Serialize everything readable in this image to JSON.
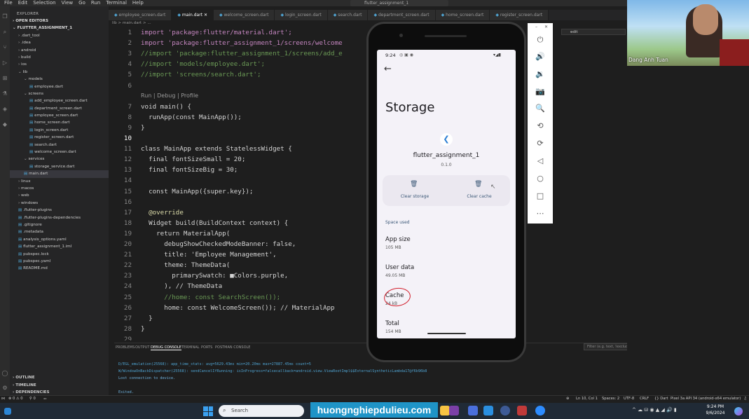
{
  "menu": [
    "File",
    "Edit",
    "Selection",
    "View",
    "Go",
    "Run",
    "Terminal",
    "Help"
  ],
  "window_title": "flutter_assignment_1",
  "explorer": {
    "title": "EXPLORER",
    "open_editors": "OPEN EDITORS",
    "project": "FLUTTER_ASSIGNMENT_1",
    "rows": [
      {
        "label": ".dart_tool",
        "indent": 1,
        "arrow": ">"
      },
      {
        "label": ".idea",
        "indent": 1,
        "arrow": ">"
      },
      {
        "label": "android",
        "indent": 1,
        "arrow": ">"
      },
      {
        "label": "build",
        "indent": 1,
        "arrow": ">"
      },
      {
        "label": "ios",
        "indent": 1,
        "arrow": ">"
      },
      {
        "label": "lib",
        "indent": 1,
        "arrow": "v"
      },
      {
        "label": "models",
        "indent": 2,
        "arrow": "v"
      },
      {
        "label": "employee.dart",
        "indent": 3,
        "arrow": ""
      },
      {
        "label": "screens",
        "indent": 2,
        "arrow": "v"
      },
      {
        "label": "add_employee_screen.dart",
        "indent": 3,
        "arrow": ""
      },
      {
        "label": "department_screen.dart",
        "indent": 3,
        "arrow": ""
      },
      {
        "label": "employee_screen.dart",
        "indent": 3,
        "arrow": ""
      },
      {
        "label": "home_screen.dart",
        "indent": 3,
        "arrow": ""
      },
      {
        "label": "login_screen.dart",
        "indent": 3,
        "arrow": ""
      },
      {
        "label": "register_screen.dart",
        "indent": 3,
        "arrow": ""
      },
      {
        "label": "search.dart",
        "indent": 3,
        "arrow": ""
      },
      {
        "label": "welcome_screen.dart",
        "indent": 3,
        "arrow": ""
      },
      {
        "label": "services",
        "indent": 2,
        "arrow": "v"
      },
      {
        "label": "storage_service.dart",
        "indent": 3,
        "arrow": ""
      },
      {
        "label": "main.dart",
        "indent": 2,
        "arrow": "",
        "selected": true
      },
      {
        "label": "linux",
        "indent": 1,
        "arrow": ">"
      },
      {
        "label": "macos",
        "indent": 1,
        "arrow": ">"
      },
      {
        "label": "web",
        "indent": 1,
        "arrow": ">"
      },
      {
        "label": "windows",
        "indent": 1,
        "arrow": ">"
      },
      {
        "label": ".flutter-plugins",
        "indent": 1,
        "arrow": ""
      },
      {
        "label": ".flutter-plugins-dependencies",
        "indent": 1,
        "arrow": ""
      },
      {
        "label": ".gitignore",
        "indent": 1,
        "arrow": ""
      },
      {
        "label": ".metadata",
        "indent": 1,
        "arrow": ""
      },
      {
        "label": "analysis_options.yaml",
        "indent": 1,
        "arrow": ""
      },
      {
        "label": "flutter_assignment_1.iml",
        "indent": 1,
        "arrow": ""
      },
      {
        "label": "pubspec.lock",
        "indent": 1,
        "arrow": ""
      },
      {
        "label": "pubspec.yaml",
        "indent": 1,
        "arrow": ""
      },
      {
        "label": "README.md",
        "indent": 1,
        "arrow": ""
      }
    ],
    "outline": "OUTLINE",
    "timeline": "TIMELINE",
    "dependencies": "DEPENDENCIES"
  },
  "tabs": [
    "employee_screen.dart",
    "main.dart",
    "welcome_screen.dart",
    "login_screen.dart",
    "search.dart",
    "department_screen.dart",
    "home_screen.dart",
    "register_screen.dart"
  ],
  "active_tab": 1,
  "breadcrumb": "lib > main.dart > ...",
  "code": [
    {
      "n": "1",
      "t": "import 'package:flutter/material.dart';"
    },
    {
      "n": "2",
      "t": "import 'package:flutter_assignment_1/screens/welcome"
    },
    {
      "n": "3",
      "t": "//import 'package:flutter_assignment_1/screens/add_e"
    },
    {
      "n": "4",
      "t": "//import 'models/employee.dart';"
    },
    {
      "n": "5",
      "t": "//import 'screens/search.dart';"
    },
    {
      "n": "6",
      "t": ""
    },
    {
      "n": "",
      "t": "Run | Debug | Profile",
      "hint": true
    },
    {
      "n": "7",
      "t": "void main() {"
    },
    {
      "n": "8",
      "t": "  runApp(const MainApp());"
    },
    {
      "n": "9",
      "t": "}"
    },
    {
      "n": "10",
      "t": ""
    },
    {
      "n": "11",
      "t": "class MainApp extends StatelessWidget {"
    },
    {
      "n": "12",
      "t": "  final fontSizeSmall = 20;"
    },
    {
      "n": "13",
      "t": "  final fontSizeBig = 30;"
    },
    {
      "n": "14",
      "t": ""
    },
    {
      "n": "15",
      "t": "  const MainApp({super.key});"
    },
    {
      "n": "16",
      "t": ""
    },
    {
      "n": "17",
      "t": "  @override"
    },
    {
      "n": "18",
      "t": "  Widget build(BuildContext context) {"
    },
    {
      "n": "19",
      "t": "    return MaterialApp("
    },
    {
      "n": "20",
      "t": "      debugShowCheckedModeBanner: false,"
    },
    {
      "n": "21",
      "t": "      title: 'Employee Management',"
    },
    {
      "n": "22",
      "t": "      theme: ThemeData("
    },
    {
      "n": "23",
      "t": "        primarySwatch: ■Colors.purple,"
    },
    {
      "n": "24",
      "t": "      ), // ThemeData"
    },
    {
      "n": "25",
      "t": "      //home: const SearchScreen());"
    },
    {
      "n": "26",
      "t": "      home: const WelcomeScreen()); // MaterialApp"
    },
    {
      "n": "27",
      "t": "  }"
    },
    {
      "n": "28",
      "t": "}"
    },
    {
      "n": "29",
      "t": ""
    }
  ],
  "panel": {
    "tabs": [
      "PROBLEMS",
      "OUTPUT",
      "DEBUG CONSOLE",
      "TERMINAL",
      "PORTS",
      "POSTMAN CONSOLE"
    ],
    "active": 2,
    "lines": [
      "D/EGL_emulation(25568): app_time_stats: avg=5629.43ms min=20.20ms max=27887.45ms count=5",
      "W/WindowOnBackDispatcher(25568): sendCancelIfRunning: isInProgress=falsecallback=android.view.ViewRootImpl$$ExternalSyntheticLambda17@f6b96b8",
      "Lost connection to device.",
      "",
      "Exited."
    ],
    "filter_placeholder": "Filter (e.g. text, !exclude, \\escape)"
  },
  "phone": {
    "time": "9:24",
    "page_title": "Storage",
    "app_name": "flutter_assignment_1",
    "version": "0.1.0",
    "clear_storage": "Clear storage",
    "clear_cache": "Clear cache",
    "space_used": "Space used",
    "app_size_label": "App size",
    "app_size_value": "105 MB",
    "user_data_label": "User data",
    "user_data_value": "49.05 MB",
    "cache_label": "Cache",
    "cache_value": "24 kB",
    "total_label": "Total",
    "total_value": "154 MB"
  },
  "right_panel": {
    "field": "edit"
  },
  "video": {
    "name": "Dang Anh Tuan"
  },
  "status": {
    "errors": "⊗ 0 ⚠ 0",
    "ports": "⚲ 0",
    "position": "Ln 10, Col 1",
    "spaces": "Spaces: 2",
    "encoding": "UTF-8",
    "eol": "CRLF",
    "language": "{} Dart",
    "device": "Pixel 3a API 34 (android-x64 emulator)"
  },
  "taskbar": {
    "search": "Search",
    "watermark": "huongnghiepdulieu.com",
    "time": "9:24 PM",
    "date": "9/6/2024"
  }
}
